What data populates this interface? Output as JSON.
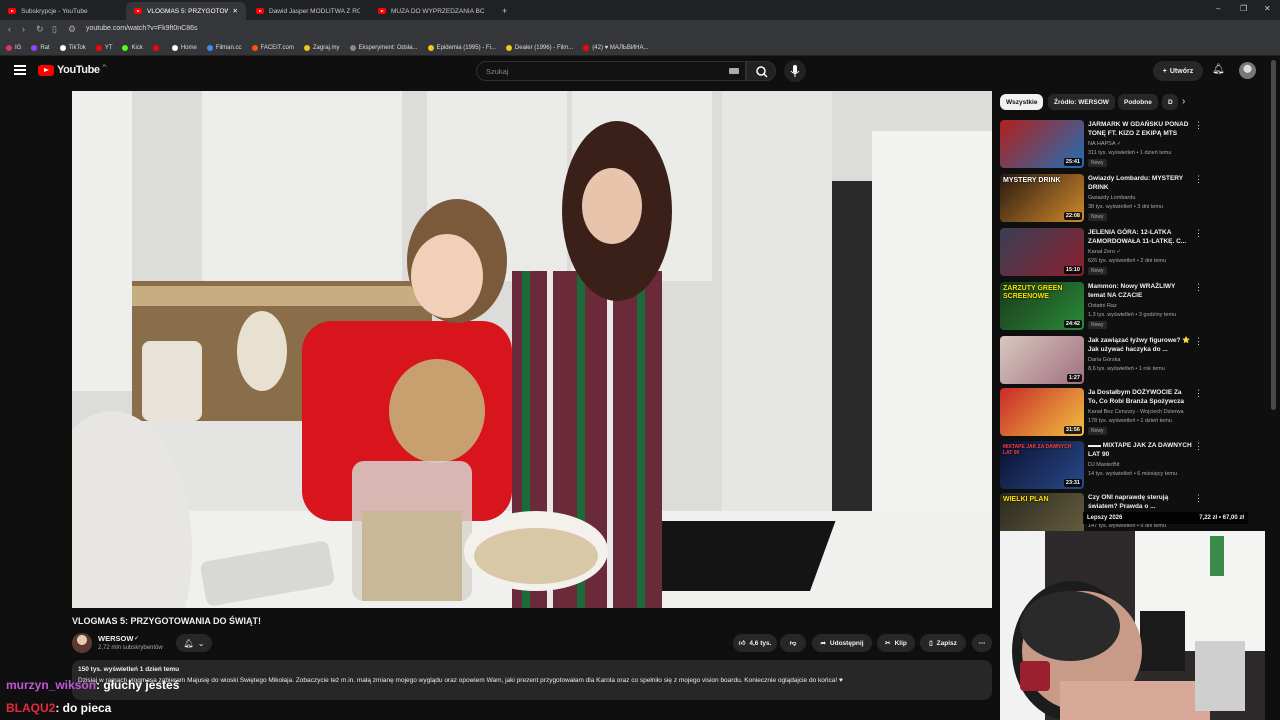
{
  "browser": {
    "tabs": [
      {
        "label": "Subskrypcje - YouTube",
        "active": false
      },
      {
        "label": "VLOGMAS 5: PRZYGOTOWAN...",
        "active": true
      },
      {
        "label": "Dawid Jasper MODLITWA Z ROBALI...",
        "active": false
      },
      {
        "label": "MUZA DO WYPRZEDZANIA BOEING...",
        "active": false
      }
    ],
    "new_tab": "+",
    "url": "youtube.com/watch?v=Fk9ft0nC86s",
    "bookmarks": [
      {
        "label": "IG",
        "color": "#e1306c"
      },
      {
        "label": "Rat",
        "color": "#9146ff"
      },
      {
        "label": "TikTok",
        "color": "#ffffff"
      },
      {
        "label": "YT",
        "color": "#ff0000"
      },
      {
        "label": "Kick",
        "color": "#53fc18"
      },
      {
        "label": "",
        "color": "#ff0000"
      },
      {
        "label": "Home",
        "color": "#ffffff"
      },
      {
        "label": "Filman.cc",
        "color": "#3d8bfd"
      },
      {
        "label": "FACEIT.com",
        "color": "#ff5500"
      },
      {
        "label": "Zagraj.my",
        "color": "#f5c518"
      },
      {
        "label": "Eksperyment: Odsła...",
        "color": "#888888"
      },
      {
        "label": "Epidemia (1995) - Fi...",
        "color": "#f5c518"
      },
      {
        "label": "Dealer (1996) - Film...",
        "color": "#f5c518"
      },
      {
        "label": "(42) ♥ МАЛЬВИНА...",
        "color": "#ff0000"
      }
    ]
  },
  "header": {
    "logo": "YouTube",
    "country": "PL",
    "search_placeholder": "Szukaj",
    "create_label": "Utwórz"
  },
  "video": {
    "title": "VLOGMAS 5: PRZYGOTOWANIA DO ŚWIĄT!",
    "channel": "WERSOW",
    "subscribers": "2,72 mln subskrybentów",
    "likes": "4,6 tys.",
    "share_label": "Udostępnij",
    "clip_label": "Klip",
    "save_label": "Zapisz",
    "views_date": "150 tys. wyświetleń  1 dzień temu",
    "description": "Dzisiaj w ramach vlogmasa zabieram Majusię do wioski Świętego Mikołaja. Zobaczycie też m.in. małą zmianę mojego wyglądu oraz opowiem Wam, jaki prezent przygotowałam dla Karola oraz co spełniło się z mojego vision boardu. Koniecznie oglądajcie do końca! ♥"
  },
  "chips": [
    "Wszystkie",
    "Źródło: WERSOW",
    "Podobne",
    "D"
  ],
  "recommendations": [
    {
      "title": "JARMARK W GDAŃSKU PONAD TONĘ FT. KIZO Z EKIPĄ MTS",
      "channel": "NA HAPSA ✓",
      "meta": "311 tys. wyświetleń • 1 dzień temu",
      "badge": "Nowy",
      "duration": "25:41",
      "thumb_text": "",
      "c1": "#b3201c",
      "c2": "#1f6fb5"
    },
    {
      "title": "Gwiazdy Lombardu: MYSTERY DRINK",
      "channel": "Gwiazdy Lombardu",
      "meta": "38 tys. wyświetleń • 3 dni temu",
      "badge": "Nowy",
      "duration": "22:08",
      "thumb_text": "MYSTERY DRINK",
      "c1": "#2a1a12",
      "c2": "#d08a2a"
    },
    {
      "title": "JELENIA GÓRA: 12-LATKA ZAMORDOWAŁA 11-LATKĘ. C...",
      "channel": "Kanał Zero ✓",
      "meta": "626 tys. wyświetleń • 2 dni temu",
      "badge": "Nowy",
      "duration": "15:10",
      "thumb_text": "",
      "c1": "#3a3f55",
      "c2": "#8a2030"
    },
    {
      "title": "Mammon: Nowy WRAŻLIWY temat NA CZACIE",
      "channel": "Ostatni Raz",
      "meta": "1,3 tys. wyświetleń • 3 godziny temu",
      "badge": "Nowy",
      "duration": "24:42",
      "thumb_text": "ZARZUTY GREEN SCREENOWE",
      "c1": "#1a3a1a",
      "c2": "#2a8a3a"
    },
    {
      "title": "Jak zawiązać łyżwy figurowe? ⭐ Jak używać haczyka do ...",
      "channel": "Daria Górska",
      "meta": "8,6 tys. wyświetleń • 1 rok temu",
      "badge": "",
      "duration": "1:27",
      "thumb_text": "",
      "c1": "#d8c8c0",
      "c2": "#a07080"
    },
    {
      "title": "Ja Dostałbym DOŻYWOCIE Za To, Co Robi Branża Spożywcza",
      "channel": "Kanał Bez Cenzury - Wojciech Dzierwa",
      "meta": "178 tys. wyświetleń • 1 dzień temu",
      "badge": "Nowy",
      "duration": "31:56",
      "thumb_text": "",
      "c1": "#c82a2a",
      "c2": "#f0c040"
    },
    {
      "title": "▬▬ MIXTAPE JAK ZA DAWNYCH LAT 90",
      "channel": "DJ MasterBit",
      "meta": "14 tys. wyświetleń • 6 miesięcy temu",
      "badge": "",
      "duration": "23:31",
      "thumb_text": "MIXTAPE JAK ZA DAWNYCH LAT 90",
      "c1": "#0a1030",
      "c2": "#2a4a8a"
    },
    {
      "title": "Czy ONI naprawdę sterują światem? Prawda o ...",
      "channel": "",
      "meta": "147 tys. wyświetleń • 9 dni temu",
      "badge": "",
      "duration": "",
      "thumb_text": "WIELKI PLAN",
      "c1": "#2a2a20",
      "c2": "#6a6040"
    }
  ],
  "overlay": {
    "price_label": "Lepszy 2026",
    "price_values": "7,22 zł • 67,00 zł",
    "chat": [
      {
        "user": "murzyn_wikson",
        "message": ": głuchy jesteś"
      },
      {
        "user": "BLAQU2",
        "message": ": do pieca"
      }
    ]
  },
  "colors": {
    "accent": "#ff0000",
    "background": "#0f0f0f",
    "surface": "#272727"
  }
}
